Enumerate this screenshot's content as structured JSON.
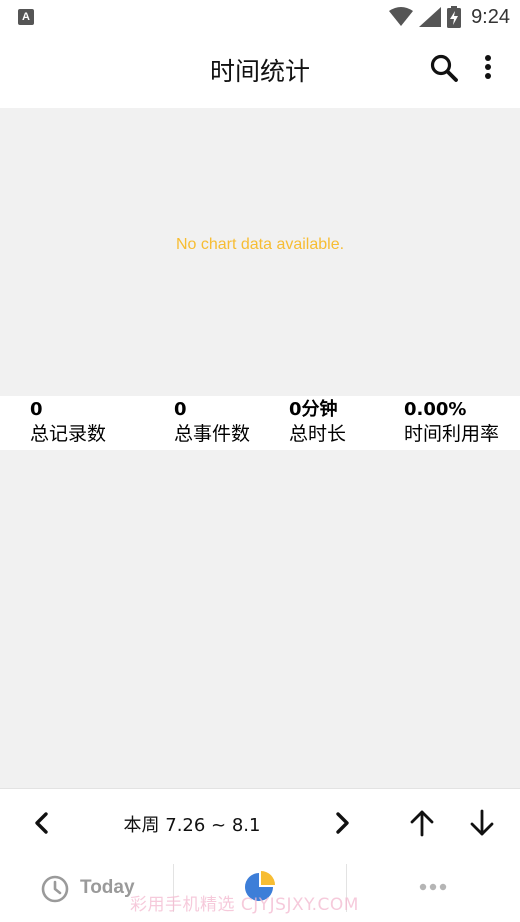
{
  "status_bar": {
    "app_icon_letter": "A",
    "time": "9:24"
  },
  "app_bar": {
    "title": "时间统计",
    "search_icon": "search-icon",
    "more_icon": "more-vert-icon"
  },
  "chart": {
    "empty_message": "No chart data available.",
    "empty_message_color": "#f7bd33",
    "background": "#f1f1f1"
  },
  "stats": [
    {
      "value": "0",
      "label": "总记录数"
    },
    {
      "value": "0",
      "label": "总事件数"
    },
    {
      "value": "0分钟",
      "label": "总时长"
    },
    {
      "value": "0.00%",
      "label": "时间利用率"
    }
  ],
  "week_nav": {
    "prev_icon": "chevron-left-icon",
    "label": "本周 7.26 ~ 8.1",
    "next_icon": "chevron-right-icon",
    "up_icon": "arrow-up-icon",
    "down_icon": "arrow-down-icon"
  },
  "tabs": [
    {
      "icon": "clock-icon",
      "label": "Today",
      "color": "#9a9a9a"
    },
    {
      "icon": "pie-chart-icon",
      "label": "",
      "colors": [
        "#3d7ed8",
        "#f7bd33"
      ]
    },
    {
      "icon": "more-horiz-icon",
      "label": "",
      "color": "#b5b5b5"
    }
  ],
  "watermark": "彩用手机精选 CJYJSJXY.COM"
}
